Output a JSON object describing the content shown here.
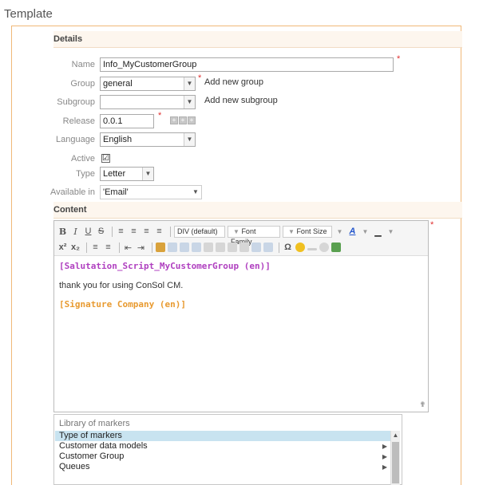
{
  "page": {
    "title": "Template"
  },
  "sections": {
    "details": "Details",
    "content": "Content"
  },
  "fields": {
    "name": {
      "label": "Name",
      "value": "Info_MyCustomerGroup"
    },
    "group": {
      "label": "Group",
      "value": "general",
      "add_link": "Add new group"
    },
    "subgroup": {
      "label": "Subgroup",
      "value": "",
      "add_link": "Add new subgroup"
    },
    "release": {
      "label": "Release",
      "value": "0.0.1"
    },
    "language": {
      "label": "Language",
      "value": "English"
    },
    "active": {
      "label": "Active",
      "checked": true,
      "check_glyph": "☑"
    },
    "type": {
      "label": "Type",
      "value": "Letter"
    },
    "available_in": {
      "label": "Available in",
      "value": "'Email'"
    }
  },
  "required_mark": "*",
  "toolbar": {
    "bold": "B",
    "italic": "I",
    "underline": "U",
    "strike": "S",
    "format_select": "DIV (default)",
    "font_family": "Font Family",
    "font_size": "Font Size",
    "superscript": "x²",
    "subscript": "x₂",
    "omega": "Ω"
  },
  "editor": {
    "line1": "[Salutation_Script_MyCustomerGroup (en)]",
    "line2": "thank you for using ConSol CM.",
    "line3": "[Signature Company (en)]",
    "colors": {
      "marker_script": "#b040c0",
      "marker_text": "#e89a30"
    }
  },
  "library": {
    "title": "Library of markers",
    "items": [
      {
        "label": "Type of markers",
        "selected": true,
        "has_sub": false
      },
      {
        "label": "Customer data models",
        "selected": false,
        "has_sub": true
      },
      {
        "label": "Customer Group",
        "selected": false,
        "has_sub": true
      },
      {
        "label": "Queues",
        "selected": false,
        "has_sub": true
      }
    ]
  },
  "colors": {
    "panel_border": "#f0b878",
    "required": "#e03030",
    "selection": "#c8e3f0"
  }
}
